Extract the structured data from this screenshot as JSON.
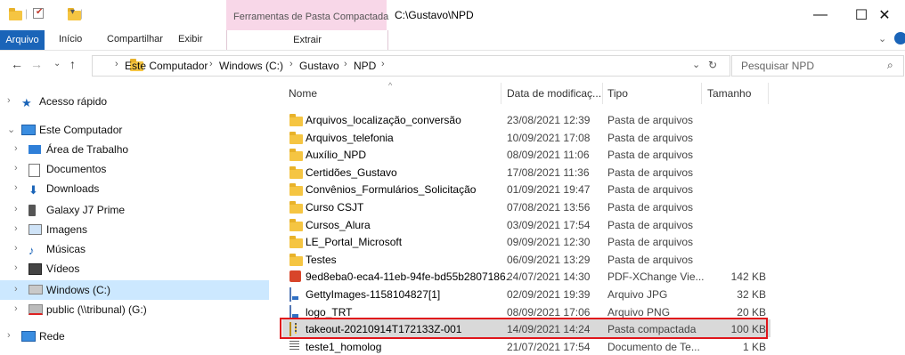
{
  "window": {
    "context_tab_header": "Ferramentas de Pasta Compactada",
    "path_title": "C:\\Gustavo\\NPD",
    "minimize": "—",
    "maximize": "☐",
    "close": "✕"
  },
  "ribbon": {
    "tabs": [
      "Arquivo",
      "Início",
      "Compartilhar",
      "Exibir"
    ],
    "context_tab": "Extrair"
  },
  "address": {
    "breadcrumbs": [
      "Este Computador",
      "Windows (C:)",
      "Gustavo",
      "NPD"
    ],
    "search_placeholder": "Pesquisar NPD"
  },
  "nav": [
    {
      "label": "Acesso rápido",
      "icon": "star-icon",
      "level": 0
    },
    {
      "label": "Este Computador",
      "icon": "computer-icon",
      "level": 0,
      "expanded": true
    },
    {
      "label": "Área de Trabalho",
      "icon": "desktop-icon",
      "level": 1
    },
    {
      "label": "Documentos",
      "icon": "documents-icon",
      "level": 1
    },
    {
      "label": "Downloads",
      "icon": "download-icon",
      "level": 1
    },
    {
      "label": "Galaxy J7 Prime",
      "icon": "phone-icon",
      "level": 1
    },
    {
      "label": "Imagens",
      "icon": "pictures-icon",
      "level": 1
    },
    {
      "label": "Músicas",
      "icon": "music-icon",
      "level": 1
    },
    {
      "label": "Vídeos",
      "icon": "video-icon",
      "level": 1
    },
    {
      "label": "Windows (C:)",
      "icon": "drive-icon",
      "level": 1,
      "selected": true
    },
    {
      "label": "public (\\\\tribunal) (G:)",
      "icon": "network-drive-icon",
      "level": 1
    },
    {
      "label": "Rede",
      "icon": "network-icon",
      "level": 0
    }
  ],
  "columns": {
    "name": "Nome",
    "date": "Data de modificaç...",
    "type": "Tipo",
    "size": "Tamanho"
  },
  "files": [
    {
      "name": "Arquivos_localização_conversão",
      "date": "23/08/2021 12:39",
      "type": "Pasta de arquivos",
      "size": "",
      "icon": "folder-icon"
    },
    {
      "name": "Arquivos_telefonia",
      "date": "10/09/2021 17:08",
      "type": "Pasta de arquivos",
      "size": "",
      "icon": "folder-icon"
    },
    {
      "name": "Auxílio_NPD",
      "date": "08/09/2021 11:06",
      "type": "Pasta de arquivos",
      "size": "",
      "icon": "folder-icon"
    },
    {
      "name": "Certidões_Gustavo",
      "date": "17/08/2021 11:36",
      "type": "Pasta de arquivos",
      "size": "",
      "icon": "folder-icon"
    },
    {
      "name": "Convênios_Formulários_Solicitação",
      "date": "01/09/2021 19:47",
      "type": "Pasta de arquivos",
      "size": "",
      "icon": "folder-icon"
    },
    {
      "name": "Curso CSJT",
      "date": "07/08/2021 13:56",
      "type": "Pasta de arquivos",
      "size": "",
      "icon": "folder-icon"
    },
    {
      "name": "Cursos_Alura",
      "date": "03/09/2021 17:54",
      "type": "Pasta de arquivos",
      "size": "",
      "icon": "folder-icon"
    },
    {
      "name": "LE_Portal_Microsoft",
      "date": "09/09/2021 12:30",
      "type": "Pasta de arquivos",
      "size": "",
      "icon": "folder-icon"
    },
    {
      "name": "Testes",
      "date": "06/09/2021 13:29",
      "type": "Pasta de arquivos",
      "size": "",
      "icon": "folder-icon"
    },
    {
      "name": "9ed8eba0-eca4-11eb-94fe-bd55b2807186...",
      "date": "24/07/2021 14:30",
      "type": "PDF-XChange Vie...",
      "size": "142 KB",
      "icon": "pdf-icon"
    },
    {
      "name": "GettyImages-1158104827[1]",
      "date": "02/09/2021 19:39",
      "type": "Arquivo JPG",
      "size": "32 KB",
      "icon": "image-icon"
    },
    {
      "name": "logo_TRT",
      "date": "08/09/2021 17:06",
      "type": "Arquivo PNG",
      "size": "20 KB",
      "icon": "image-icon"
    },
    {
      "name": "takeout-20210914T172133Z-001",
      "date": "14/09/2021 14:24",
      "type": "Pasta compactada",
      "size": "100 KB",
      "icon": "zip-icon",
      "selected": true
    },
    {
      "name": "teste1_homolog",
      "date": "21/07/2021 17:54",
      "type": "Documento de Te...",
      "size": "1 KB",
      "icon": "text-file-icon"
    }
  ],
  "colors": {
    "accent": "#1a64b8",
    "context_tab": "#f8d7e8",
    "selection": "#cce8ff",
    "highlight": "#e0151b"
  }
}
